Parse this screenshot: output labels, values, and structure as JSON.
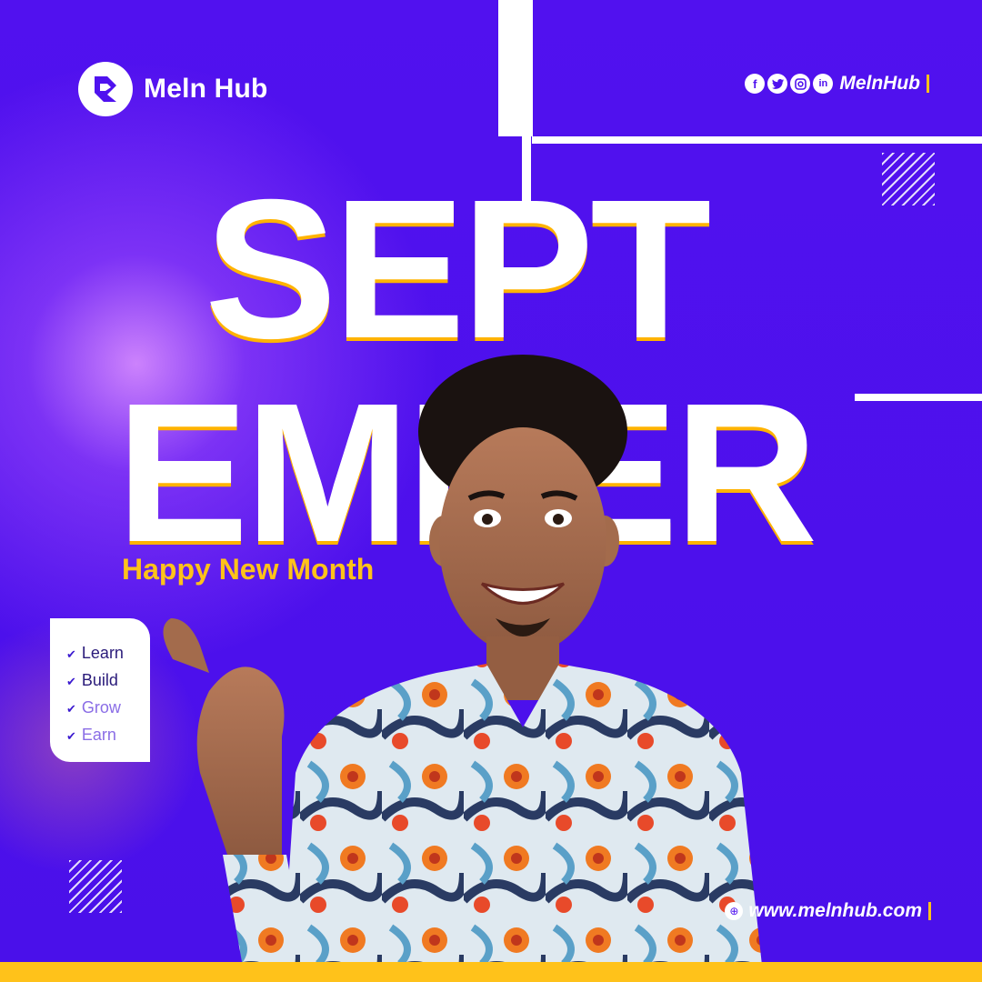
{
  "brand": {
    "name": "Meln Hub",
    "social_handle": "MelnHub",
    "website": "www.melnhub.com",
    "colors": {
      "background": "#4f12ef",
      "accent": "#ffc21a",
      "text": "#ffffff"
    }
  },
  "social_icons": [
    "facebook-icon",
    "twitter-icon",
    "instagram-icon",
    "linkedin-icon"
  ],
  "headline": {
    "line1": "SEPT",
    "line2": "EMBER",
    "subtitle": "Happy New Month"
  },
  "checklist": {
    "items": [
      "Learn",
      "Build",
      "Grow",
      "Earn"
    ]
  }
}
